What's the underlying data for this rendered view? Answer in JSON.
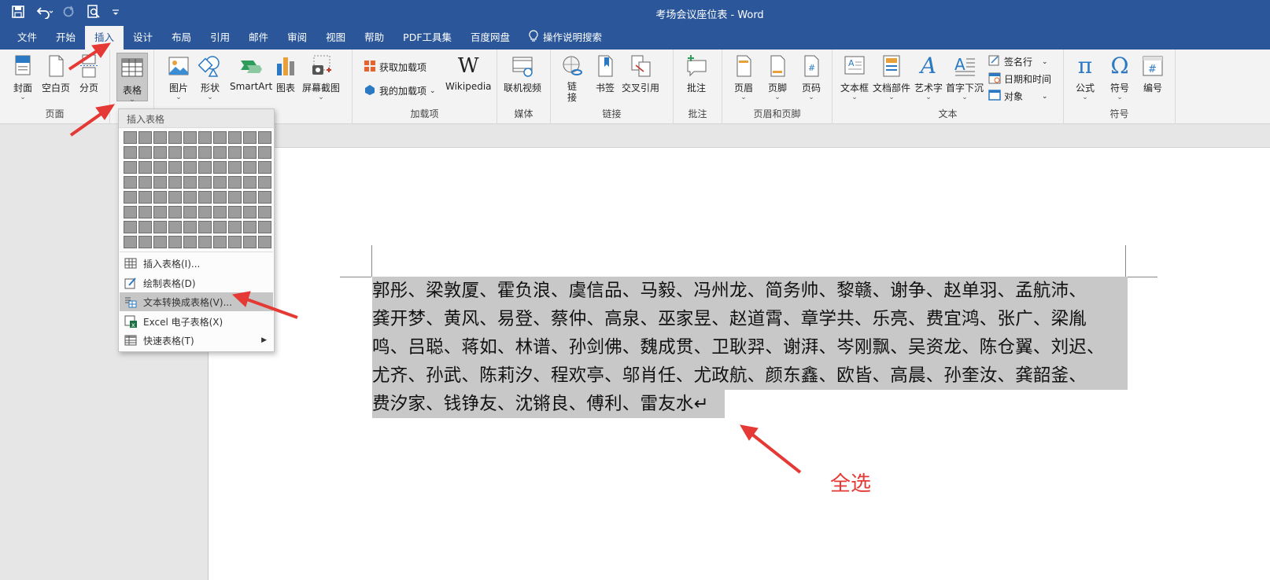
{
  "window": {
    "title": "考场会议座位表  -  Word"
  },
  "tabs": [
    "文件",
    "开始",
    "插入",
    "设计",
    "布局",
    "引用",
    "邮件",
    "审阅",
    "视图",
    "帮助",
    "PDF工具集",
    "百度网盘"
  ],
  "tell_me": "操作说明搜索",
  "ribbon": {
    "groups": {
      "pages": "页面",
      "table": "",
      "addins": "加载项",
      "media": "媒体",
      "links": "链接",
      "comments": "批注",
      "header_footer": "页眉和页脚",
      "text": "文本",
      "symbols": "符号"
    },
    "buttons": {
      "cover": "封面",
      "blank": "空白页",
      "break": "分页",
      "table": "表格",
      "picture": "图片",
      "shape": "形状",
      "smartart": "SmartArt",
      "chart": "图表",
      "screenshot": "屏幕截图",
      "get_addins": "获取加载项",
      "my_addins": "我的加载项",
      "wikipedia": "Wikipedia",
      "online_video": "联机视频",
      "link": "链\n接",
      "bookmark": "书签",
      "crossref": "交叉引用",
      "comment": "批注",
      "header": "页眉",
      "footer": "页脚",
      "pagenum": "页码",
      "textbox": "文本框",
      "quickparts": "文档部件",
      "wordart": "艺术字",
      "dropcap": "首字下沉",
      "signature": "签名行",
      "datetime": "日期和时间",
      "object": "对象",
      "equation": "公式",
      "symbol": "符号",
      "number": "编号"
    }
  },
  "dropdown": {
    "title": "插入表格",
    "items": [
      "插入表格(I)...",
      "绘制表格(D)",
      "文本转换成表格(V)...",
      "Excel 电子表格(X)",
      "快速表格(T)"
    ]
  },
  "document": {
    "lines": [
      "郭彤、梁敦厦、霍负浪、虞信品、马毅、冯州龙、简务帅、黎赣、谢争、赵单羽、孟航沛、",
      "龚开梦、黄风、易登、蔡仲、高泉、巫家昱、赵道霄、章学共、乐亮、费宜鸿、张广、梁胤",
      "鸣、吕聪、蒋如、林谱、孙剑佛、魏成贯、卫耿羿、谢湃、岑刚飘、吴资龙、陈仓翼、刘迟、",
      "尤齐、孙武、陈莉汐、程欢亭、邬肖任、尤政航、颜东鑫、欧皆、高晨、孙奎汝、龚韶釜、",
      "费汐家、钱铮友、沈锵良、傅利、雷友水↵"
    ]
  },
  "annotation": "全选"
}
